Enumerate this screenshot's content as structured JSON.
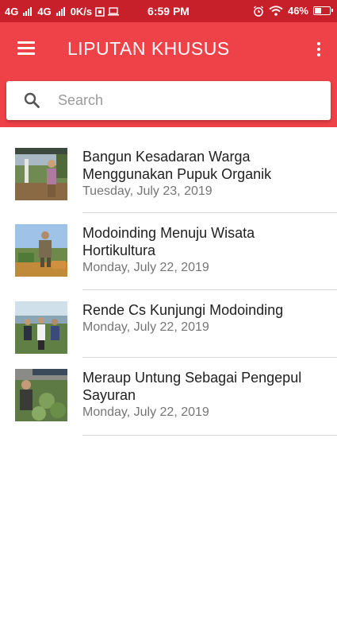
{
  "status_bar": {
    "net1": "4G",
    "net2": "4G",
    "speed": "0K/s",
    "time": "6:59 PM",
    "battery": "46%",
    "battery_level": 0.46
  },
  "app_bar": {
    "title": "LIPUTAN KHUSUS",
    "menu_icon": "hamburger-menu-icon",
    "more_icon": "more-vertical-icon"
  },
  "search": {
    "placeholder": "Search",
    "value": ""
  },
  "articles": [
    {
      "title": "Bangun Kesadaran Warga Menggunakan Pupuk Organik",
      "date": "Tuesday, July 23, 2019"
    },
    {
      "title": "Modoinding Menuju Wisata Hortikultura",
      "date": "Monday, July 22, 2019"
    },
    {
      "title": "Rende Cs Kunjungi Modoinding",
      "date": "Monday, July 22, 2019"
    },
    {
      "title": "Meraup Untung Sebagai Pengepul Sayuran",
      "date": "Monday, July 22, 2019"
    }
  ],
  "colors": {
    "status_bar": "#c8202a",
    "app_bar": "#ee4248"
  }
}
